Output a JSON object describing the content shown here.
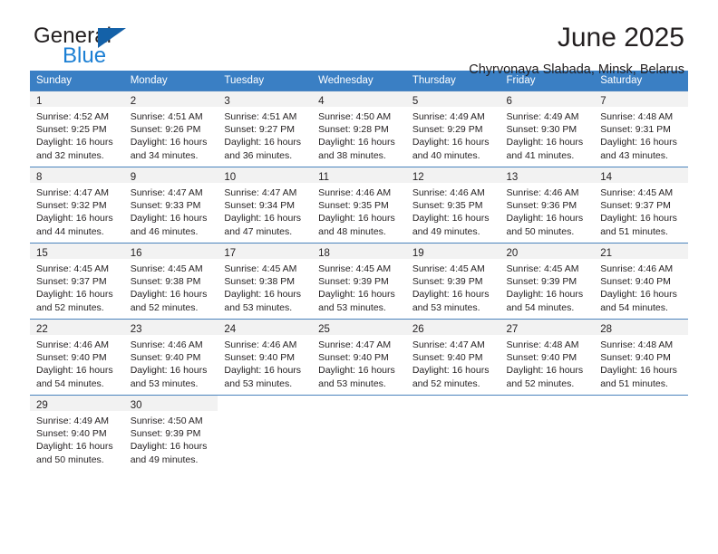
{
  "brand": {
    "name_top": "General",
    "name_bottom": "Blue",
    "accent_color": "#1b7fd4",
    "triangle_color": "#1461a8"
  },
  "header": {
    "title": "June 2025",
    "subtitle": "Chyrvonaya Slabada, Minsk, Belarus"
  },
  "calendar": {
    "header_bg": "#3a7fc4",
    "header_text_color": "#ffffff",
    "daynum_bg": "#f2f2f2",
    "weekday_headers": [
      "Sunday",
      "Monday",
      "Tuesday",
      "Wednesday",
      "Thursday",
      "Friday",
      "Saturday"
    ],
    "weeks": [
      [
        {
          "day": "1",
          "sunrise": "Sunrise: 4:52 AM",
          "sunset": "Sunset: 9:25 PM",
          "daylight_1": "Daylight: 16 hours",
          "daylight_2": "and 32 minutes."
        },
        {
          "day": "2",
          "sunrise": "Sunrise: 4:51 AM",
          "sunset": "Sunset: 9:26 PM",
          "daylight_1": "Daylight: 16 hours",
          "daylight_2": "and 34 minutes."
        },
        {
          "day": "3",
          "sunrise": "Sunrise: 4:51 AM",
          "sunset": "Sunset: 9:27 PM",
          "daylight_1": "Daylight: 16 hours",
          "daylight_2": "and 36 minutes."
        },
        {
          "day": "4",
          "sunrise": "Sunrise: 4:50 AM",
          "sunset": "Sunset: 9:28 PM",
          "daylight_1": "Daylight: 16 hours",
          "daylight_2": "and 38 minutes."
        },
        {
          "day": "5",
          "sunrise": "Sunrise: 4:49 AM",
          "sunset": "Sunset: 9:29 PM",
          "daylight_1": "Daylight: 16 hours",
          "daylight_2": "and 40 minutes."
        },
        {
          "day": "6",
          "sunrise": "Sunrise: 4:49 AM",
          "sunset": "Sunset: 9:30 PM",
          "daylight_1": "Daylight: 16 hours",
          "daylight_2": "and 41 minutes."
        },
        {
          "day": "7",
          "sunrise": "Sunrise: 4:48 AM",
          "sunset": "Sunset: 9:31 PM",
          "daylight_1": "Daylight: 16 hours",
          "daylight_2": "and 43 minutes."
        }
      ],
      [
        {
          "day": "8",
          "sunrise": "Sunrise: 4:47 AM",
          "sunset": "Sunset: 9:32 PM",
          "daylight_1": "Daylight: 16 hours",
          "daylight_2": "and 44 minutes."
        },
        {
          "day": "9",
          "sunrise": "Sunrise: 4:47 AM",
          "sunset": "Sunset: 9:33 PM",
          "daylight_1": "Daylight: 16 hours",
          "daylight_2": "and 46 minutes."
        },
        {
          "day": "10",
          "sunrise": "Sunrise: 4:47 AM",
          "sunset": "Sunset: 9:34 PM",
          "daylight_1": "Daylight: 16 hours",
          "daylight_2": "and 47 minutes."
        },
        {
          "day": "11",
          "sunrise": "Sunrise: 4:46 AM",
          "sunset": "Sunset: 9:35 PM",
          "daylight_1": "Daylight: 16 hours",
          "daylight_2": "and 48 minutes."
        },
        {
          "day": "12",
          "sunrise": "Sunrise: 4:46 AM",
          "sunset": "Sunset: 9:35 PM",
          "daylight_1": "Daylight: 16 hours",
          "daylight_2": "and 49 minutes."
        },
        {
          "day": "13",
          "sunrise": "Sunrise: 4:46 AM",
          "sunset": "Sunset: 9:36 PM",
          "daylight_1": "Daylight: 16 hours",
          "daylight_2": "and 50 minutes."
        },
        {
          "day": "14",
          "sunrise": "Sunrise: 4:45 AM",
          "sunset": "Sunset: 9:37 PM",
          "daylight_1": "Daylight: 16 hours",
          "daylight_2": "and 51 minutes."
        }
      ],
      [
        {
          "day": "15",
          "sunrise": "Sunrise: 4:45 AM",
          "sunset": "Sunset: 9:37 PM",
          "daylight_1": "Daylight: 16 hours",
          "daylight_2": "and 52 minutes."
        },
        {
          "day": "16",
          "sunrise": "Sunrise: 4:45 AM",
          "sunset": "Sunset: 9:38 PM",
          "daylight_1": "Daylight: 16 hours",
          "daylight_2": "and 52 minutes."
        },
        {
          "day": "17",
          "sunrise": "Sunrise: 4:45 AM",
          "sunset": "Sunset: 9:38 PM",
          "daylight_1": "Daylight: 16 hours",
          "daylight_2": "and 53 minutes."
        },
        {
          "day": "18",
          "sunrise": "Sunrise: 4:45 AM",
          "sunset": "Sunset: 9:39 PM",
          "daylight_1": "Daylight: 16 hours",
          "daylight_2": "and 53 minutes."
        },
        {
          "day": "19",
          "sunrise": "Sunrise: 4:45 AM",
          "sunset": "Sunset: 9:39 PM",
          "daylight_1": "Daylight: 16 hours",
          "daylight_2": "and 53 minutes."
        },
        {
          "day": "20",
          "sunrise": "Sunrise: 4:45 AM",
          "sunset": "Sunset: 9:39 PM",
          "daylight_1": "Daylight: 16 hours",
          "daylight_2": "and 54 minutes."
        },
        {
          "day": "21",
          "sunrise": "Sunrise: 4:46 AM",
          "sunset": "Sunset: 9:40 PM",
          "daylight_1": "Daylight: 16 hours",
          "daylight_2": "and 54 minutes."
        }
      ],
      [
        {
          "day": "22",
          "sunrise": "Sunrise: 4:46 AM",
          "sunset": "Sunset: 9:40 PM",
          "daylight_1": "Daylight: 16 hours",
          "daylight_2": "and 54 minutes."
        },
        {
          "day": "23",
          "sunrise": "Sunrise: 4:46 AM",
          "sunset": "Sunset: 9:40 PM",
          "daylight_1": "Daylight: 16 hours",
          "daylight_2": "and 53 minutes."
        },
        {
          "day": "24",
          "sunrise": "Sunrise: 4:46 AM",
          "sunset": "Sunset: 9:40 PM",
          "daylight_1": "Daylight: 16 hours",
          "daylight_2": "and 53 minutes."
        },
        {
          "day": "25",
          "sunrise": "Sunrise: 4:47 AM",
          "sunset": "Sunset: 9:40 PM",
          "daylight_1": "Daylight: 16 hours",
          "daylight_2": "and 53 minutes."
        },
        {
          "day": "26",
          "sunrise": "Sunrise: 4:47 AM",
          "sunset": "Sunset: 9:40 PM",
          "daylight_1": "Daylight: 16 hours",
          "daylight_2": "and 52 minutes."
        },
        {
          "day": "27",
          "sunrise": "Sunrise: 4:48 AM",
          "sunset": "Sunset: 9:40 PM",
          "daylight_1": "Daylight: 16 hours",
          "daylight_2": "and 52 minutes."
        },
        {
          "day": "28",
          "sunrise": "Sunrise: 4:48 AM",
          "sunset": "Sunset: 9:40 PM",
          "daylight_1": "Daylight: 16 hours",
          "daylight_2": "and 51 minutes."
        }
      ],
      [
        {
          "day": "29",
          "sunrise": "Sunrise: 4:49 AM",
          "sunset": "Sunset: 9:40 PM",
          "daylight_1": "Daylight: 16 hours",
          "daylight_2": "and 50 minutes."
        },
        {
          "day": "30",
          "sunrise": "Sunrise: 4:50 AM",
          "sunset": "Sunset: 9:39 PM",
          "daylight_1": "Daylight: 16 hours",
          "daylight_2": "and 49 minutes."
        },
        null,
        null,
        null,
        null,
        null
      ]
    ]
  }
}
